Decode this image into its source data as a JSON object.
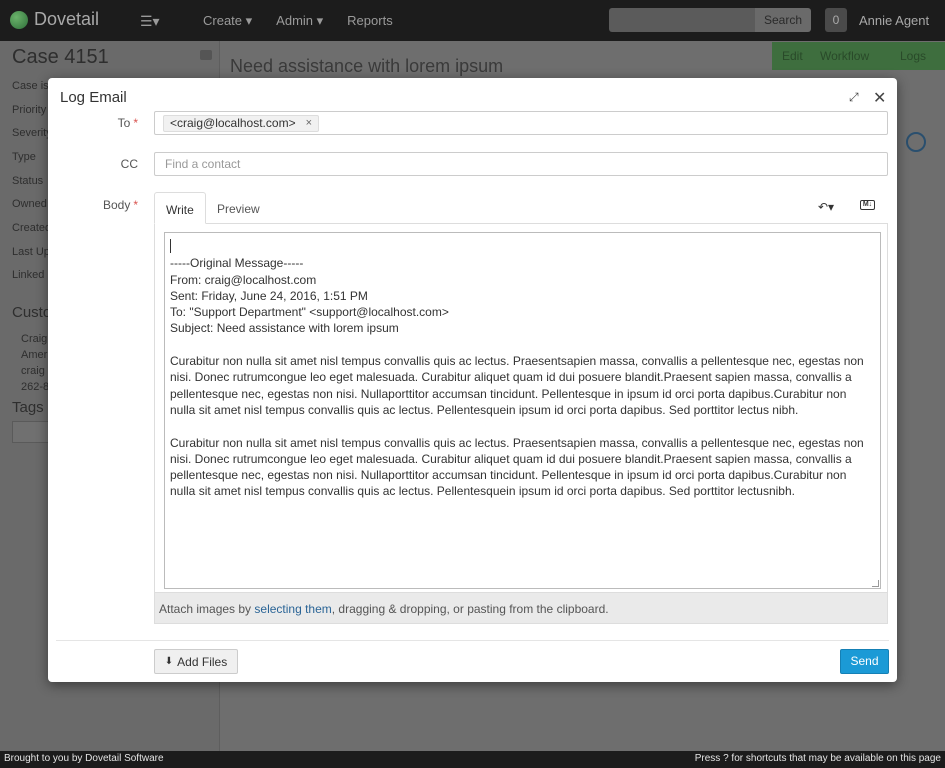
{
  "navbar": {
    "brand": "Dovetail",
    "menu": [
      {
        "label": "Create",
        "has_dropdown": true
      },
      {
        "label": "Admin",
        "has_dropdown": true
      },
      {
        "label": "Reports",
        "has_dropdown": false
      }
    ],
    "search_button": "Search",
    "notification_count": "0",
    "user_name": "Annie Agent"
  },
  "background_page": {
    "case_title": "Case 4151",
    "case_subject": "Need assistance with lorem ipsum",
    "fields": [
      "Case is",
      "Priority",
      "Severity",
      "Type",
      "Status",
      "Owned",
      "Created",
      "Last Up",
      "Linked"
    ],
    "customer_section": "Custo",
    "customer_lines": [
      "Craig",
      "Amer",
      "craig",
      "262-8"
    ],
    "tags_section": "Tags",
    "actions": [
      "Edit",
      "Workflow",
      "Logs"
    ]
  },
  "modal": {
    "title": "Log Email",
    "to_label": "To",
    "to_recipient": "<craig@localhost.com>",
    "cc_label": "CC",
    "cc_placeholder": "Find a contact",
    "body_label": "Body",
    "tabs": [
      "Write",
      "Preview"
    ],
    "active_tab": "Write",
    "body_header_lines": [
      "-----Original Message-----",
      "From: craig@localhost.com",
      "Sent: Friday, June 24, 2016, 1:51 PM",
      "To: \"Support Department\" <support@localhost.com>",
      "Subject: Need assistance with lorem ipsum"
    ],
    "body_paragraph_1": [
      "Curabitur non nulla sit amet nisl tempus convallis quis ac lectus. Praesentsapien massa, convallis a pellentesque nec, egestas non",
      "nisi. Donec rutrumcongue leo eget malesuada. Curabitur aliquet quam id dui posuere blandit.Praesent sapien massa, convallis a",
      "pellentesque nec, egestas non nisi. Nullaporttitor accumsan tincidunt. Pellentesque in ipsum id orci porta dapibus.Curabitur non",
      "nulla sit amet nisl tempus convallis quis ac lectus. Pellentesquein ipsum id orci porta dapibus. Sed porttitor lectus nibh."
    ],
    "body_paragraph_2": [
      "Curabitur non nulla sit amet nisl tempus convallis quis ac lectus. Praesentsapien massa, convallis a pellentesque nec, egestas non",
      "nisi. Donec rutrumcongue leo eget malesuada. Curabitur aliquet quam id dui posuere blandit.Praesent sapien massa, convallis a",
      "pellentesque nec, egestas non nisi. Nullaporttitor accumsan tincidunt. Pellentesque in ipsum id orci porta dapibus.Curabitur non",
      "nulla sit amet nisl tempus convallis quis ac lectus. Pellentesquein ipsum id orci porta dapibus. Sed porttitor lectusnibh."
    ],
    "attach_prefix": "Attach images by ",
    "attach_link": "selecting them",
    "attach_suffix": ", dragging & dropping, or pasting from the clipboard.",
    "add_files_button": "Add Files",
    "send_button": "Send",
    "send_color": "#1b9ad6",
    "icons": [
      "compress-icon",
      "close-icon",
      "reply-icon",
      "markdown-icon",
      "upload-icon"
    ]
  },
  "footer": {
    "left": "Brought to you by Dovetail Software",
    "right": "Press ? for shortcuts that may be available on this page"
  }
}
